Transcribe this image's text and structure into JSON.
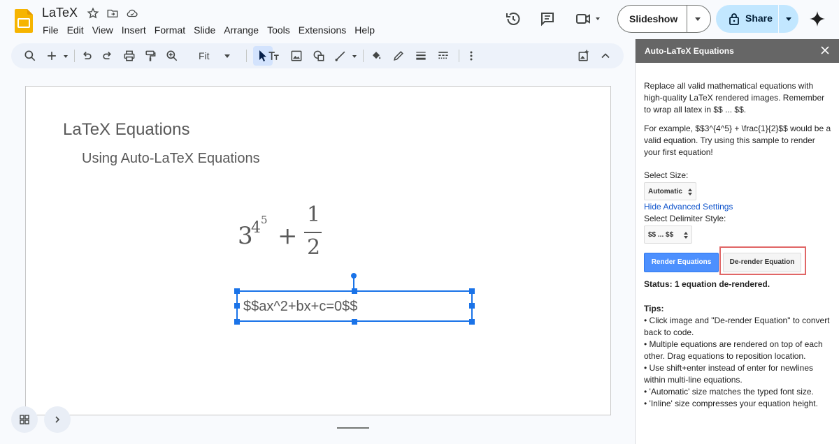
{
  "app": {
    "doc_title": "LaTeX",
    "menu": [
      "File",
      "Edit",
      "View",
      "Insert",
      "Format",
      "Slide",
      "Arrange",
      "Tools",
      "Extensions",
      "Help"
    ],
    "slideshow_label": "Slideshow",
    "share_label": "Share",
    "zoom_label": "Fit"
  },
  "slide": {
    "title": "LaTeX Equations",
    "subtitle": "Using Auto-LaTeX Equations",
    "equation": {
      "base": "3",
      "exp1": "4",
      "exp2": "5",
      "plus": "+",
      "numerator": "1",
      "denominator": "2"
    },
    "selected_text": "$$ax^2+bx+c=0$$"
  },
  "sidebar": {
    "title": "Auto-LaTeX Equations",
    "intro": "Replace all valid mathematical equations with high-quality LaTeX rendered images. Remember to wrap all latex in $$ ... $$.",
    "example": "For example, $$3^{4^5} + \\frac{1}{2}$$ would be a valid equation. Try using this sample to render your first equation!",
    "size_label": "Select Size:",
    "size_value": "Automatic",
    "advanced_link": "Hide Advanced Settings",
    "delim_label": "Select Delimiter Style:",
    "delim_value": "$$ ... $$",
    "render_label": "Render Equations",
    "derender_label": "De-render Equation",
    "status": "Status: 1 equation de-rendered.",
    "tips_heading": "Tips:",
    "tips": [
      "• Click image and \"De-render Equation\" to convert back to code.",
      "• Multiple equations are rendered on top of each other. Drag equations to reposition location.",
      "• Use shift+enter instead of enter for newlines within multi-line equations.",
      "• 'Automatic' size matches the typed font size.",
      "• 'Inline' size compresses your equation height."
    ]
  },
  "colors": {
    "accent": "#1a73e8",
    "share_bg": "#c2e7ff",
    "highlight": "#e06666",
    "render_button": "#4d90fe"
  }
}
